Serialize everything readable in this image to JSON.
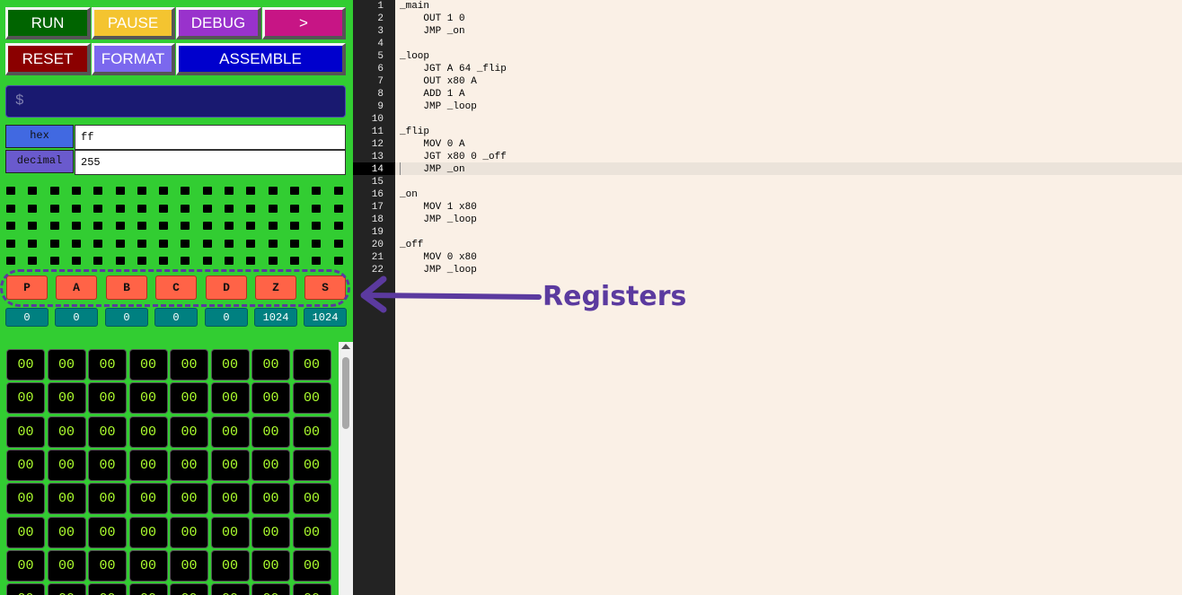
{
  "controls": {
    "run": {
      "label": "RUN",
      "color": "#006400"
    },
    "pause": {
      "label": "PAUSE",
      "color": "#f4c430"
    },
    "debug": {
      "label": "DEBUG",
      "color": "#9932cc"
    },
    "step": {
      "label": ">",
      "color": "#c71585"
    },
    "reset": {
      "label": "RESET",
      "color": "#8b0000"
    },
    "format": {
      "label": "FORMAT",
      "color": "#7b68ee"
    },
    "assemble": {
      "label": "ASSEMBLE",
      "color": "#0000cd"
    }
  },
  "terminal": {
    "prompt": "$"
  },
  "converter": {
    "hex_label": "hex",
    "hex_value": "ff",
    "decimal_label": "decimal",
    "decimal_value": "255"
  },
  "registers": [
    {
      "name": "P",
      "value": "0"
    },
    {
      "name": "A",
      "value": "0"
    },
    {
      "name": "B",
      "value": "0"
    },
    {
      "name": "C",
      "value": "0"
    },
    {
      "name": "D",
      "value": "0"
    },
    {
      "name": "Z",
      "value": "1024"
    },
    {
      "name": "S",
      "value": "1024"
    }
  ],
  "memory_cell_value": "00",
  "editor": {
    "active_line": 14,
    "lines": [
      "_main",
      "    OUT 1 0",
      "    JMP _on",
      "",
      "_loop",
      "    JGT A 64 _flip",
      "    OUT x80 A",
      "    ADD 1 A",
      "    JMP _loop",
      "",
      "_flip",
      "    MOV 0 A",
      "    JGT x80 0 _off",
      "    JMP _on",
      "",
      "_on",
      "    MOV 1 x80",
      "    JMP _loop",
      "",
      "_off",
      "    MOV 0 x80",
      "    JMP _loop"
    ]
  },
  "annotation": {
    "label": "Registers",
    "color": "#5b3a9f"
  }
}
